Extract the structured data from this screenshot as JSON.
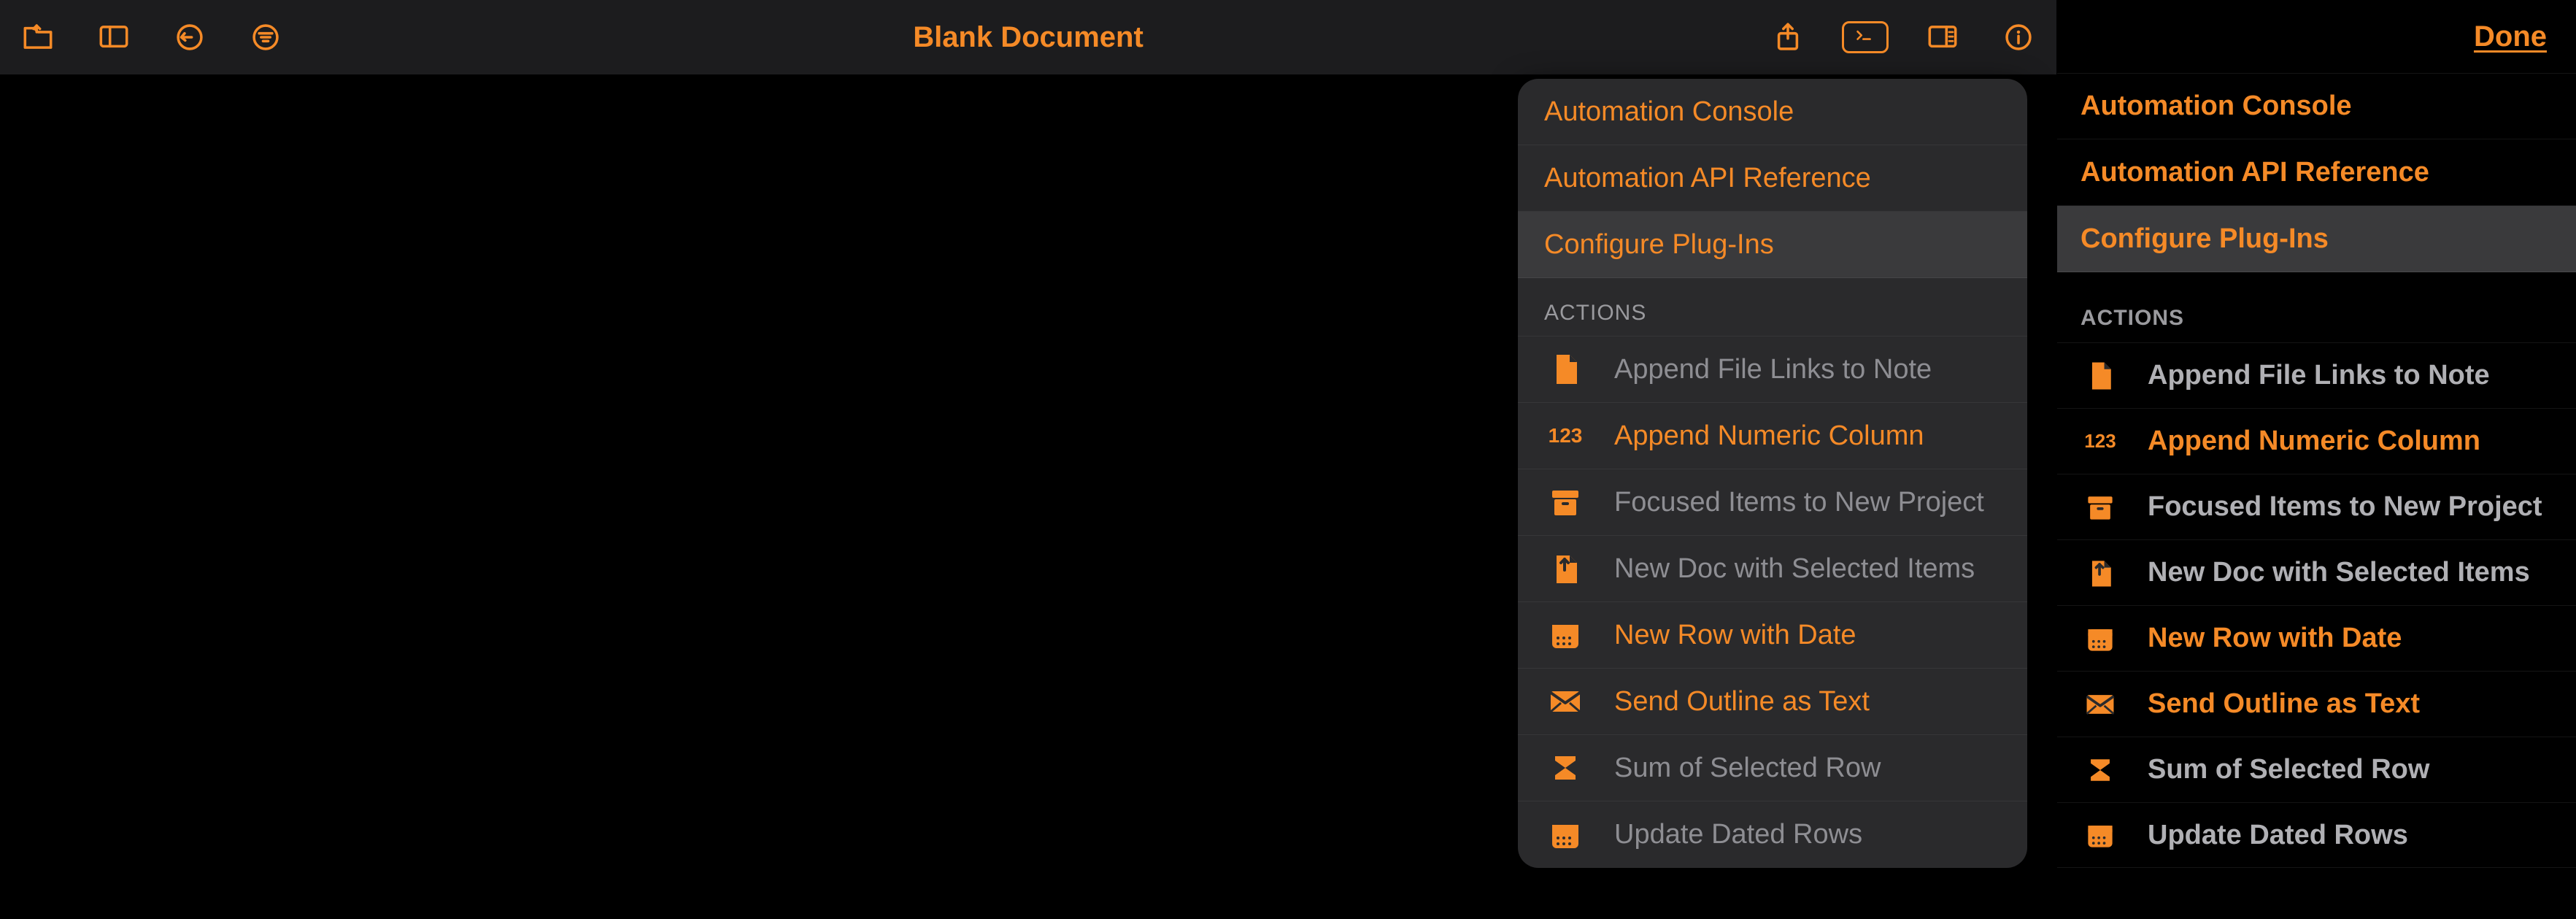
{
  "header": {
    "title": "Blank Document"
  },
  "popover": {
    "items": [
      {
        "label": "Automation Console",
        "selected": false
      },
      {
        "label": "Automation API Reference",
        "selected": false
      },
      {
        "label": "Configure Plug-Ins",
        "selected": true
      }
    ],
    "actions_header": "ACTIONS",
    "actions": [
      {
        "icon": "file",
        "label": "Append File Links to Note",
        "enabled": false
      },
      {
        "icon": "num123",
        "label": "Append Numeric Column",
        "enabled": true
      },
      {
        "icon": "archive",
        "label": "Focused Items to New Project",
        "enabled": false
      },
      {
        "icon": "newdoc",
        "label": "New Doc with Selected Items",
        "enabled": false
      },
      {
        "icon": "calendar",
        "label": "New Row with Date",
        "enabled": true
      },
      {
        "icon": "mail",
        "label": "Send Outline as Text",
        "enabled": true
      },
      {
        "icon": "sigma",
        "label": "Sum of Selected Row",
        "enabled": false
      },
      {
        "icon": "calendar",
        "label": "Update Dated Rows",
        "enabled": false
      }
    ]
  },
  "config_pane": {
    "done_label": "Done",
    "items": [
      {
        "label": "Automation Console",
        "selected": false
      },
      {
        "label": "Automation API Reference",
        "selected": false
      },
      {
        "label": "Configure Plug-Ins",
        "selected": true
      }
    ],
    "actions_header": "ACTIONS",
    "actions": [
      {
        "icon": "file",
        "label": "Append File Links to Note",
        "enabled": false
      },
      {
        "icon": "num123",
        "label": "Append Numeric Column",
        "enabled": true
      },
      {
        "icon": "archive",
        "label": "Focused Items to New Project",
        "enabled": false
      },
      {
        "icon": "newdoc",
        "label": "New Doc with Selected Items",
        "enabled": false
      },
      {
        "icon": "calendar",
        "label": "New Row with Date",
        "enabled": true
      },
      {
        "icon": "mail",
        "label": "Send Outline as Text",
        "enabled": true
      },
      {
        "icon": "sigma",
        "label": "Sum of Selected Row",
        "enabled": false
      },
      {
        "icon": "calendar",
        "label": "Update Dated Rows",
        "enabled": false
      }
    ]
  }
}
